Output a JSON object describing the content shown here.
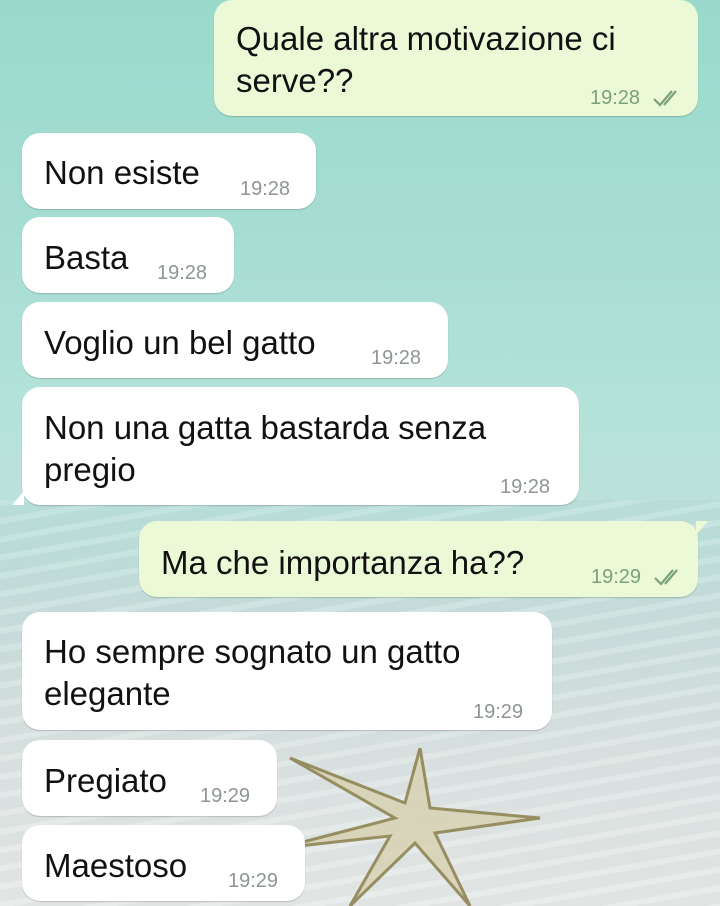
{
  "messages": [
    {
      "direction": "out",
      "text": "Quale altra motivazione ci\nserve??",
      "time": "19:28",
      "status": "read"
    },
    {
      "direction": "in",
      "text": "Non esiste",
      "time": "19:28"
    },
    {
      "direction": "in",
      "text": "Basta",
      "time": "19:28"
    },
    {
      "direction": "in",
      "text": "Voglio un bel gatto",
      "time": "19:28"
    },
    {
      "direction": "in",
      "text": "Non una gatta bastarda senza\npregio",
      "time": "19:28"
    },
    {
      "direction": "out",
      "text": "Ma che importanza ha??",
      "time": "19:29",
      "status": "read"
    },
    {
      "direction": "in",
      "text": "Ho sempre sognato un gatto\nelegante",
      "time": "19:29"
    },
    {
      "direction": "in",
      "text": "Pregiato",
      "time": "19:29"
    },
    {
      "direction": "in",
      "text": "Maestoso",
      "time": "19:29"
    }
  ],
  "colors": {
    "incoming_bubble": "#ffffff",
    "outgoing_bubble": "#ecf9d6",
    "read_ticks": "#7aa17c",
    "timestamp": "#8e9693"
  }
}
